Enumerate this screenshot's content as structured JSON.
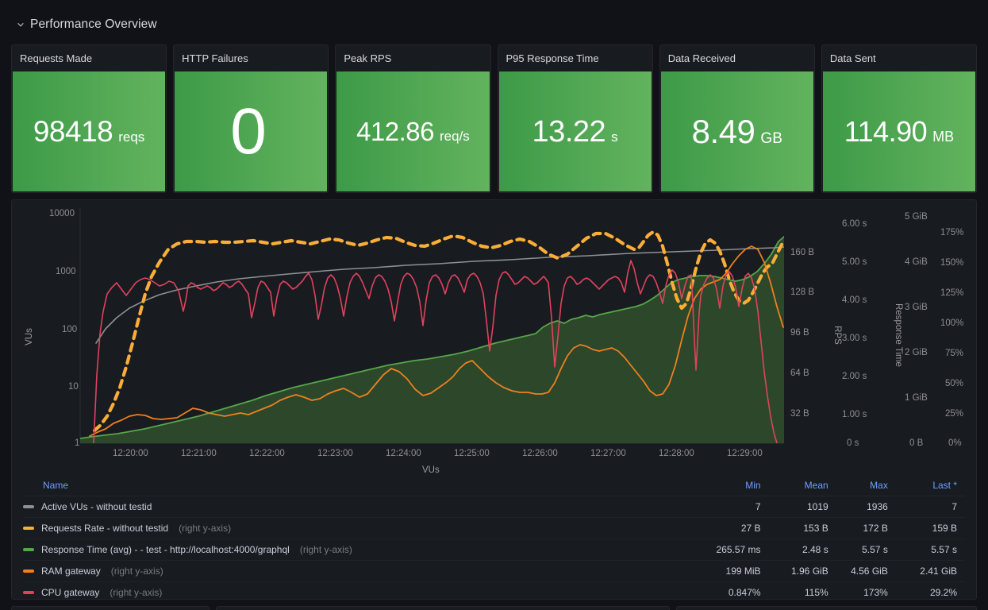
{
  "row": {
    "title": "Performance Overview",
    "collapse_icon": "chevron-down-icon"
  },
  "stats": [
    {
      "title": "Requests Made",
      "value": "98418",
      "unit": "reqs",
      "value_font_px": 37,
      "unit_font_px": 17,
      "color_from": "#3d9a47",
      "color_to": "#63b35e"
    },
    {
      "title": "HTTP Failures",
      "value": "0",
      "unit": "",
      "value_font_px": 82,
      "unit_font_px": 17,
      "color_from": "#3d9a47",
      "color_to": "#63b35e"
    },
    {
      "title": "Peak RPS",
      "value": "412.86",
      "unit": "req/s",
      "value_font_px": 33,
      "unit_font_px": 17,
      "color_from": "#3d9a47",
      "color_to": "#63b35e"
    },
    {
      "title": "P95 Response Time",
      "value": "13.22",
      "unit": "s",
      "value_font_px": 38,
      "unit_font_px": 17,
      "color_from": "#3d9a47",
      "color_to": "#63b35e"
    },
    {
      "title": "Data Received",
      "value": "8.49",
      "unit": "GB",
      "value_font_px": 42,
      "unit_font_px": 19,
      "color_from": "#3d9a47",
      "color_to": "#63b35e"
    },
    {
      "title": "Data Sent",
      "value": "114.90",
      "unit": "MB",
      "value_font_px": 36,
      "unit_font_px": 18,
      "color_from": "#3d9a47",
      "color_to": "#63b35e"
    }
  ],
  "chart_data": {
    "type": "line",
    "title": "",
    "xlabel": "VUs",
    "x_ticks": [
      "12:20:00",
      "12:21:00",
      "12:22:00",
      "12:23:00",
      "12:24:00",
      "12:25:00",
      "12:26:00",
      "12:27:00",
      "12:28:00",
      "12:29:00"
    ],
    "grid": false,
    "legend_position": "bottom-table",
    "axes": [
      {
        "id": "left-vus",
        "side": "left",
        "title": "VUs",
        "scale": "log",
        "ticks": [
          "1",
          "10",
          "100",
          "1000",
          "10000"
        ]
      },
      {
        "id": "right-bytes",
        "side": "right",
        "title": "",
        "scale": "linear",
        "ticks": [
          "32 B",
          "64 B",
          "96 B",
          "128 B",
          "160 B"
        ]
      },
      {
        "id": "right-rps",
        "side": "right",
        "title": "RPS",
        "scale": "linear",
        "ticks": [
          "0 s",
          "1.00 s",
          "2.00 s",
          "3.00 s",
          "4.00 s",
          "5.00 s",
          "6.00 s"
        ]
      },
      {
        "id": "right-resp",
        "side": "right",
        "title": "Response Time",
        "scale": "linear",
        "ticks": [
          "0 B",
          "1 GiB",
          "2 GiB",
          "3 GiB",
          "4 GiB",
          "5 GiB"
        ]
      },
      {
        "id": "right-percent",
        "side": "right",
        "title": "",
        "scale": "linear",
        "ticks": [
          "0%",
          "25%",
          "50%",
          "75%",
          "100%",
          "125%",
          "150%",
          "175%"
        ]
      }
    ],
    "series": [
      {
        "name": "Active VUs - without testid",
        "color": "#8e9094",
        "style": "solid",
        "fill": false,
        "axis": "left-vus"
      },
      {
        "name": "Requests Rate - without testid",
        "color": "#fbad37",
        "style": "dashed",
        "fill": false,
        "axis": "right-bytes"
      },
      {
        "name": "Response Time (avg) - - test - http://localhost:4000/graphql",
        "color": "#56a64b",
        "style": "solid",
        "fill": true,
        "axis": "right-rps"
      },
      {
        "name": "RAM gateway",
        "color": "#ef8020",
        "style": "solid",
        "fill": false,
        "axis": "right-resp"
      },
      {
        "name": "CPU gateway",
        "color": "#e0435e",
        "style": "solid",
        "fill": false,
        "axis": "right-percent"
      }
    ]
  },
  "legend": {
    "columns": [
      "Name",
      "Min",
      "Mean",
      "Max",
      "Last *"
    ],
    "rows": [
      {
        "color": "#8e9094",
        "name": "Active VUs - without testid",
        "axis_note": "",
        "min": "7",
        "mean": "1019",
        "max": "1936",
        "last": "7"
      },
      {
        "color": "#fbad37",
        "name": "Requests Rate - without testid",
        "axis_note": "(right y-axis)",
        "min": "27 B",
        "mean": "153 B",
        "max": "172 B",
        "last": "159 B"
      },
      {
        "color": "#56a64b",
        "name": "Response Time (avg) - - test - http://localhost:4000/graphql",
        "axis_note": "(right y-axis)",
        "min": "265.57 ms",
        "mean": "2.48 s",
        "max": "5.57 s",
        "last": "5.57 s"
      },
      {
        "color": "#ef8020",
        "name": "RAM gateway",
        "axis_note": "(right y-axis)",
        "min": "199 MiB",
        "mean": "1.96 GiB",
        "max": "4.56 GiB",
        "last": "2.41 GiB"
      },
      {
        "color": "#e0435e",
        "name": "CPU gateway",
        "axis_note": "(right y-axis)",
        "min": "0.847%",
        "mean": "115%",
        "max": "173%",
        "last": "29.2%"
      }
    ]
  }
}
